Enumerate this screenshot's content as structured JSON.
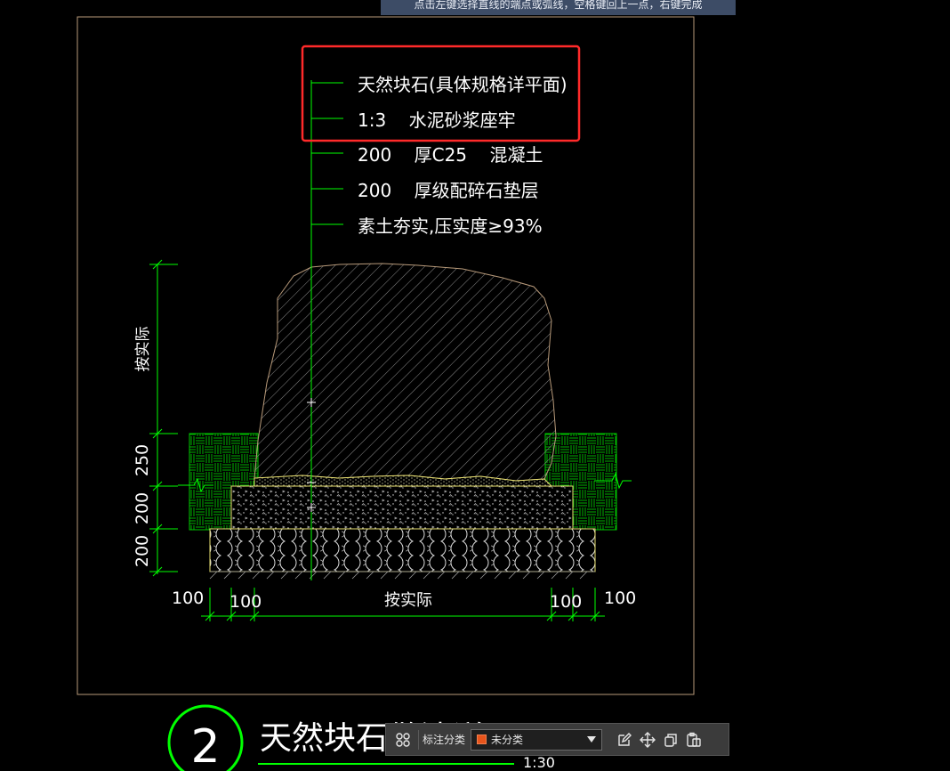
{
  "hint_bar": {
    "text": "点击左键选择直线的端点或弧线，空格键回上一点，右键完成"
  },
  "drawing": {
    "callouts": [
      "天然块石(具体规格详平面)",
      "1:3    水泥砂浆座牢",
      "200    厚C25    混凝土",
      "200    厚级配碎石垫层",
      "素土夯实,压实度≥93%"
    ],
    "dims_vertical": [
      "按实际",
      "250",
      "200",
      "200"
    ],
    "dims_horizontal": [
      "100",
      "100",
      "按实际",
      "100",
      "100"
    ],
    "detail_number": "2",
    "detail_title": "天然块石做法详图",
    "detail_scale": "1:30"
  },
  "toolbar": {
    "category_label": "标注分类",
    "category_value": "未分类",
    "category_color": "#e8541b"
  },
  "colors": {
    "background": "#000000",
    "annotation_highlight": "#ff2a2a",
    "leader": "#00ff00",
    "frame": "#b89a7a",
    "hint_bg": "#3d4c66"
  }
}
